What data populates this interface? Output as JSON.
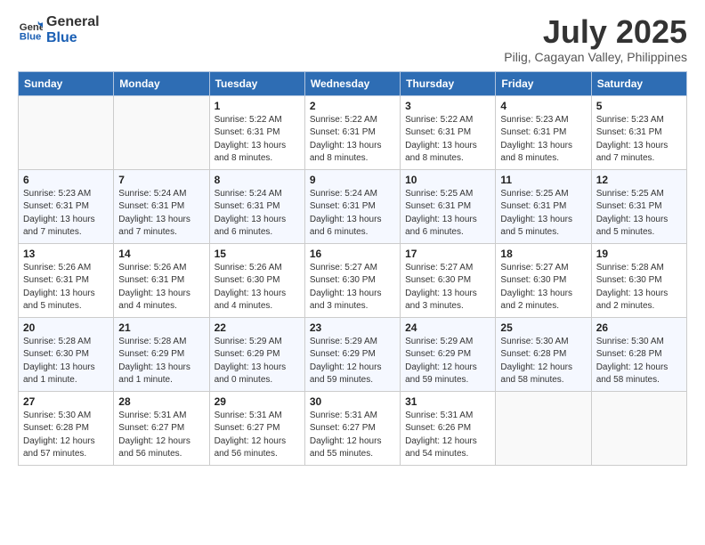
{
  "header": {
    "logo_general": "General",
    "logo_blue": "Blue",
    "title": "July 2025",
    "subtitle": "Pilig, Cagayan Valley, Philippines"
  },
  "weekdays": [
    "Sunday",
    "Monday",
    "Tuesday",
    "Wednesday",
    "Thursday",
    "Friday",
    "Saturday"
  ],
  "weeks": [
    [
      {
        "day": "",
        "details": ""
      },
      {
        "day": "",
        "details": ""
      },
      {
        "day": "1",
        "details": "Sunrise: 5:22 AM\nSunset: 6:31 PM\nDaylight: 13 hours and 8 minutes."
      },
      {
        "day": "2",
        "details": "Sunrise: 5:22 AM\nSunset: 6:31 PM\nDaylight: 13 hours and 8 minutes."
      },
      {
        "day": "3",
        "details": "Sunrise: 5:22 AM\nSunset: 6:31 PM\nDaylight: 13 hours and 8 minutes."
      },
      {
        "day": "4",
        "details": "Sunrise: 5:23 AM\nSunset: 6:31 PM\nDaylight: 13 hours and 8 minutes."
      },
      {
        "day": "5",
        "details": "Sunrise: 5:23 AM\nSunset: 6:31 PM\nDaylight: 13 hours and 7 minutes."
      }
    ],
    [
      {
        "day": "6",
        "details": "Sunrise: 5:23 AM\nSunset: 6:31 PM\nDaylight: 13 hours and 7 minutes."
      },
      {
        "day": "7",
        "details": "Sunrise: 5:24 AM\nSunset: 6:31 PM\nDaylight: 13 hours and 7 minutes."
      },
      {
        "day": "8",
        "details": "Sunrise: 5:24 AM\nSunset: 6:31 PM\nDaylight: 13 hours and 6 minutes."
      },
      {
        "day": "9",
        "details": "Sunrise: 5:24 AM\nSunset: 6:31 PM\nDaylight: 13 hours and 6 minutes."
      },
      {
        "day": "10",
        "details": "Sunrise: 5:25 AM\nSunset: 6:31 PM\nDaylight: 13 hours and 6 minutes."
      },
      {
        "day": "11",
        "details": "Sunrise: 5:25 AM\nSunset: 6:31 PM\nDaylight: 13 hours and 5 minutes."
      },
      {
        "day": "12",
        "details": "Sunrise: 5:25 AM\nSunset: 6:31 PM\nDaylight: 13 hours and 5 minutes."
      }
    ],
    [
      {
        "day": "13",
        "details": "Sunrise: 5:26 AM\nSunset: 6:31 PM\nDaylight: 13 hours and 5 minutes."
      },
      {
        "day": "14",
        "details": "Sunrise: 5:26 AM\nSunset: 6:31 PM\nDaylight: 13 hours and 4 minutes."
      },
      {
        "day": "15",
        "details": "Sunrise: 5:26 AM\nSunset: 6:30 PM\nDaylight: 13 hours and 4 minutes."
      },
      {
        "day": "16",
        "details": "Sunrise: 5:27 AM\nSunset: 6:30 PM\nDaylight: 13 hours and 3 minutes."
      },
      {
        "day": "17",
        "details": "Sunrise: 5:27 AM\nSunset: 6:30 PM\nDaylight: 13 hours and 3 minutes."
      },
      {
        "day": "18",
        "details": "Sunrise: 5:27 AM\nSunset: 6:30 PM\nDaylight: 13 hours and 2 minutes."
      },
      {
        "day": "19",
        "details": "Sunrise: 5:28 AM\nSunset: 6:30 PM\nDaylight: 13 hours and 2 minutes."
      }
    ],
    [
      {
        "day": "20",
        "details": "Sunrise: 5:28 AM\nSunset: 6:30 PM\nDaylight: 13 hours and 1 minute."
      },
      {
        "day": "21",
        "details": "Sunrise: 5:28 AM\nSunset: 6:29 PM\nDaylight: 13 hours and 1 minute."
      },
      {
        "day": "22",
        "details": "Sunrise: 5:29 AM\nSunset: 6:29 PM\nDaylight: 13 hours and 0 minutes."
      },
      {
        "day": "23",
        "details": "Sunrise: 5:29 AM\nSunset: 6:29 PM\nDaylight: 12 hours and 59 minutes."
      },
      {
        "day": "24",
        "details": "Sunrise: 5:29 AM\nSunset: 6:29 PM\nDaylight: 12 hours and 59 minutes."
      },
      {
        "day": "25",
        "details": "Sunrise: 5:30 AM\nSunset: 6:28 PM\nDaylight: 12 hours and 58 minutes."
      },
      {
        "day": "26",
        "details": "Sunrise: 5:30 AM\nSunset: 6:28 PM\nDaylight: 12 hours and 58 minutes."
      }
    ],
    [
      {
        "day": "27",
        "details": "Sunrise: 5:30 AM\nSunset: 6:28 PM\nDaylight: 12 hours and 57 minutes."
      },
      {
        "day": "28",
        "details": "Sunrise: 5:31 AM\nSunset: 6:27 PM\nDaylight: 12 hours and 56 minutes."
      },
      {
        "day": "29",
        "details": "Sunrise: 5:31 AM\nSunset: 6:27 PM\nDaylight: 12 hours and 56 minutes."
      },
      {
        "day": "30",
        "details": "Sunrise: 5:31 AM\nSunset: 6:27 PM\nDaylight: 12 hours and 55 minutes."
      },
      {
        "day": "31",
        "details": "Sunrise: 5:31 AM\nSunset: 6:26 PM\nDaylight: 12 hours and 54 minutes."
      },
      {
        "day": "",
        "details": ""
      },
      {
        "day": "",
        "details": ""
      }
    ]
  ]
}
